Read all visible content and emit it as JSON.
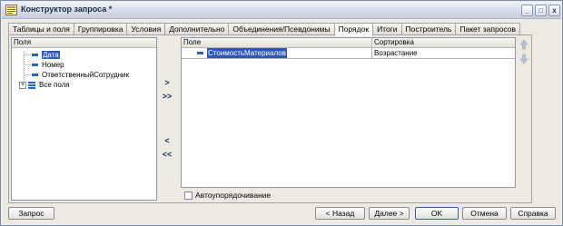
{
  "window": {
    "title": "Конструктор запроса *",
    "minimize_glyph": "_",
    "maximize_glyph": "□",
    "close_glyph": "x"
  },
  "tabs": [
    {
      "label": "Таблицы и поля",
      "active": false
    },
    {
      "label": "Группировка",
      "active": false
    },
    {
      "label": "Условия",
      "active": false
    },
    {
      "label": "Дополнительно",
      "active": false
    },
    {
      "label": "Объединения/Псевдонимы",
      "active": false
    },
    {
      "label": "Порядок",
      "active": true
    },
    {
      "label": "Итоги",
      "active": false
    },
    {
      "label": "Построитель",
      "active": false
    },
    {
      "label": "Пакет запросов",
      "active": false
    }
  ],
  "fields_panel": {
    "header": "Поля",
    "items": [
      "Дата",
      "Номер",
      "ОтветственныйСотрудник",
      "Все поля"
    ],
    "selected_index": 0,
    "expander_glyph": "+"
  },
  "move_buttons": {
    "add": ">",
    "add_all": ">>",
    "remove": "<",
    "remove_all": "<<"
  },
  "order_table": {
    "columns": [
      "Поле",
      "Сортировка"
    ],
    "rows": [
      {
        "field": "СтоимостьМатериалов",
        "sort": "Возрастание"
      }
    ]
  },
  "auto_order": {
    "label": "Автоупорядочивание",
    "checked": false
  },
  "buttons": {
    "query": "Запрос",
    "back": "< Назад",
    "next": "Далее >",
    "ok": "OK",
    "cancel": "Отмена",
    "help": "Справка"
  },
  "colors": {
    "selection": "#2c58b4",
    "field_icon": "#2a63b8",
    "window_bg": "#eceae3"
  }
}
